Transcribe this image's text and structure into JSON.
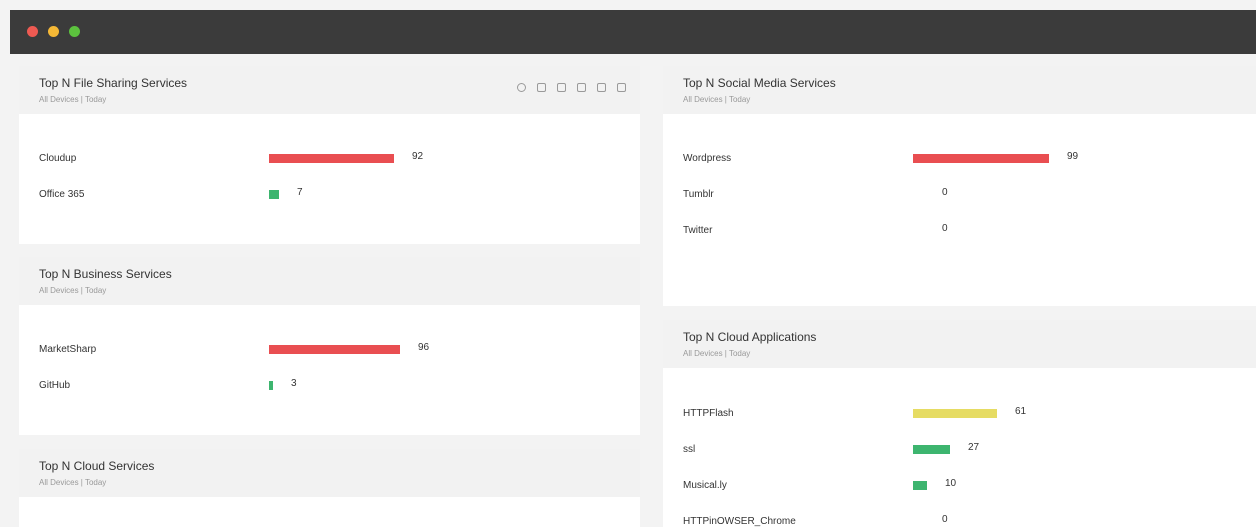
{
  "colors": {
    "red": "#e94e51",
    "green": "#3db56f",
    "yellow": "#e6dc63"
  },
  "toolbar_icons": [
    "refresh-icon",
    "list-icon",
    "edit-icon",
    "copy-icon",
    "expand-icon",
    "menu-icon"
  ],
  "panels": {
    "file_sharing": {
      "title": "Top N File Sharing Services",
      "subtitle": "All Devices | Today",
      "rows": [
        {
          "label": "Cloudup",
          "value": "92",
          "fraction": 0.92,
          "color": "#e94e51"
        },
        {
          "label": "Office 365",
          "value": "7",
          "fraction": 0.07,
          "color": "#3db56f"
        }
      ]
    },
    "business": {
      "title": "Top N Business Services",
      "subtitle": "All Devices | Today",
      "rows": [
        {
          "label": "MarketSharp",
          "value": "96",
          "fraction": 0.96,
          "color": "#e94e51"
        },
        {
          "label": "GitHub",
          "value": "3",
          "fraction": 0.03,
          "color": "#3db56f"
        }
      ]
    },
    "cloud_services": {
      "title": "Top N Cloud Services",
      "subtitle": "All Devices | Today"
    },
    "social_media": {
      "title": "Top N Social Media Services",
      "subtitle": "All Devices | Today",
      "rows": [
        {
          "label": "Wordpress",
          "value": "99",
          "fraction": 0.99,
          "color": "#e94e51"
        },
        {
          "label": "Tumblr",
          "value": "0",
          "fraction": 0,
          "color": "#e94e51"
        },
        {
          "label": "Twitter",
          "value": "0",
          "fraction": 0,
          "color": "#e94e51"
        }
      ]
    },
    "cloud_apps": {
      "title": "Top N Cloud Applications",
      "subtitle": "All Devices | Today",
      "rows": [
        {
          "label": "HTTPFlash",
          "value": "61",
          "fraction": 0.61,
          "color": "#e6dc63"
        },
        {
          "label": "ssl",
          "value": "27",
          "fraction": 0.27,
          "color": "#3db56f"
        },
        {
          "label": "Musical.ly",
          "value": "10",
          "fraction": 0.1,
          "color": "#3db56f"
        },
        {
          "label": "HTTPinOWSER_Chrome",
          "value": "0",
          "fraction": 0,
          "color": "#3db56f"
        }
      ]
    }
  }
}
